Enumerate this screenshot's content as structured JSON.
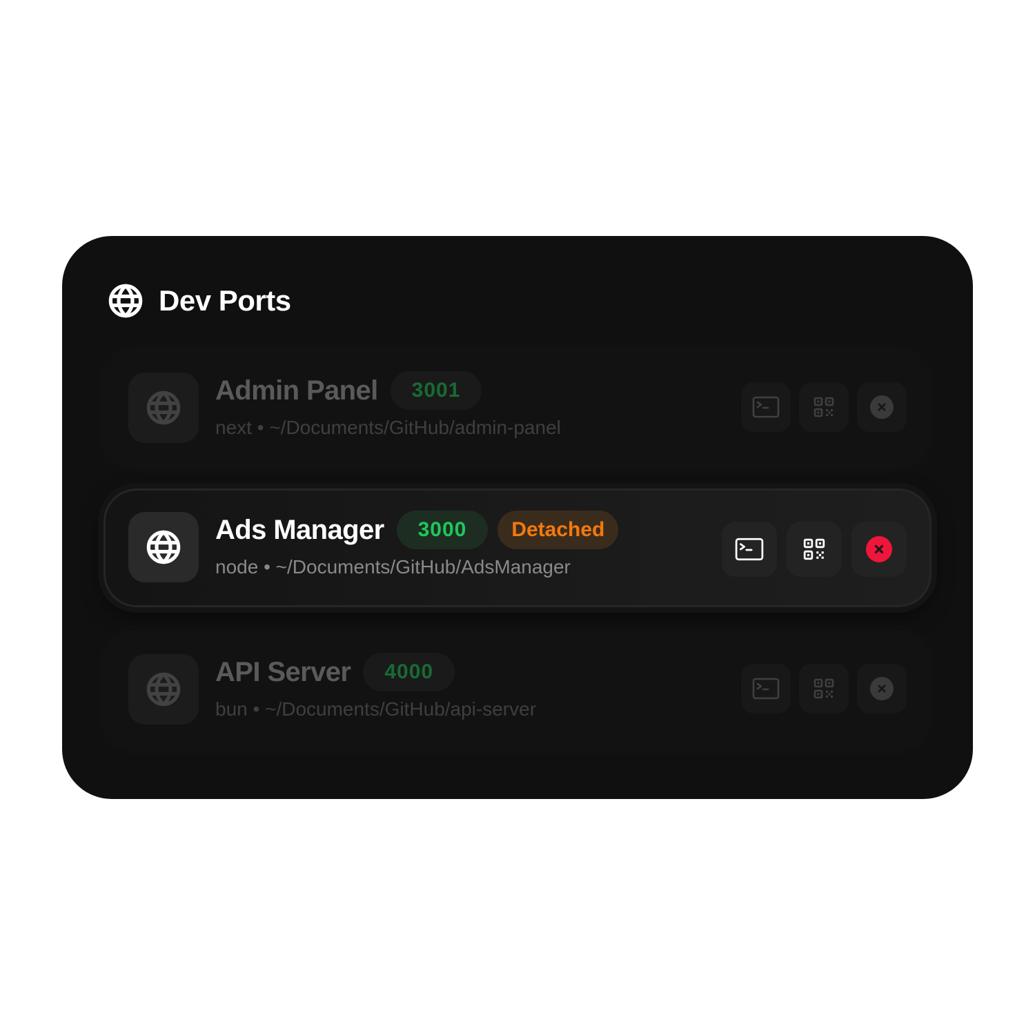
{
  "header": {
    "title": "Dev Ports",
    "icon": "globe-icon"
  },
  "rows": [
    {
      "name": "Admin Panel",
      "port": "3001",
      "runtime": "next",
      "separator": "•",
      "path": "~/Documents/GitHub/admin-panel",
      "status": "",
      "state": "dim"
    },
    {
      "name": "Ads Manager",
      "port": "3000",
      "runtime": "node",
      "separator": "•",
      "path": "~/Documents/GitHub/AdsManager",
      "status": "Detached",
      "state": "active"
    },
    {
      "name": "API Server",
      "port": "4000",
      "runtime": "bun",
      "separator": "•",
      "path": "~/Documents/GitHub/api-server",
      "status": "",
      "state": "dim"
    }
  ],
  "colors": {
    "panel_bg": "#101010",
    "port_green": "#1fc75b",
    "status_orange": "#f3790d",
    "close_red": "#f0153a"
  }
}
